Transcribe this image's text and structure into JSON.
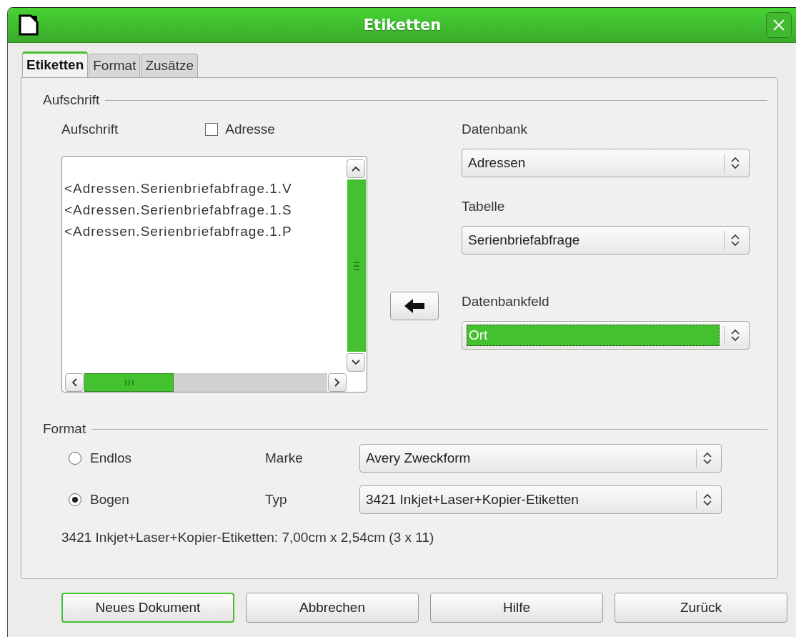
{
  "window": {
    "title": "Etiketten"
  },
  "tabs": [
    {
      "label": "Etiketten",
      "selected": true
    },
    {
      "label": "Format",
      "selected": false
    },
    {
      "label": "Zusätze",
      "selected": false
    }
  ],
  "inscription": {
    "heading": "Aufschrift",
    "label": "Aufschrift",
    "address_checkbox": {
      "label": "Adresse",
      "checked": false
    },
    "lines": [
      "<Adressen.Serienbriefabfrage.1.V",
      "<Adressen.Serienbriefabfrage.1.S",
      "<Adressen.Serienbriefabfrage.1.P"
    ]
  },
  "database": {
    "label": "Datenbank",
    "value": "Adressen",
    "selected": false
  },
  "table": {
    "label": "Tabelle",
    "value": "Serienbriefabfrage",
    "selected": false
  },
  "database_field": {
    "label": "Datenbankfeld",
    "value": "Ort",
    "selected": true
  },
  "format": {
    "heading": "Format",
    "options": [
      {
        "label": "Endlos",
        "selected": false
      },
      {
        "label": "Bogen",
        "selected": true
      }
    ],
    "brand": {
      "label": "Marke",
      "value": "Avery Zweckform"
    },
    "type": {
      "label": "Typ",
      "value": "3421 Inkjet+Laser+Kopier-Etiketten"
    },
    "info": "3421 Inkjet+Laser+Kopier-Etiketten: 7,00cm x 2,54cm (3 x 11)"
  },
  "buttons": [
    {
      "label": "Neues Dokument",
      "focused": true
    },
    {
      "label": "Abbrechen",
      "focused": false
    },
    {
      "label": "Hilfe",
      "focused": false
    },
    {
      "label": "Zurück",
      "focused": false
    }
  ]
}
